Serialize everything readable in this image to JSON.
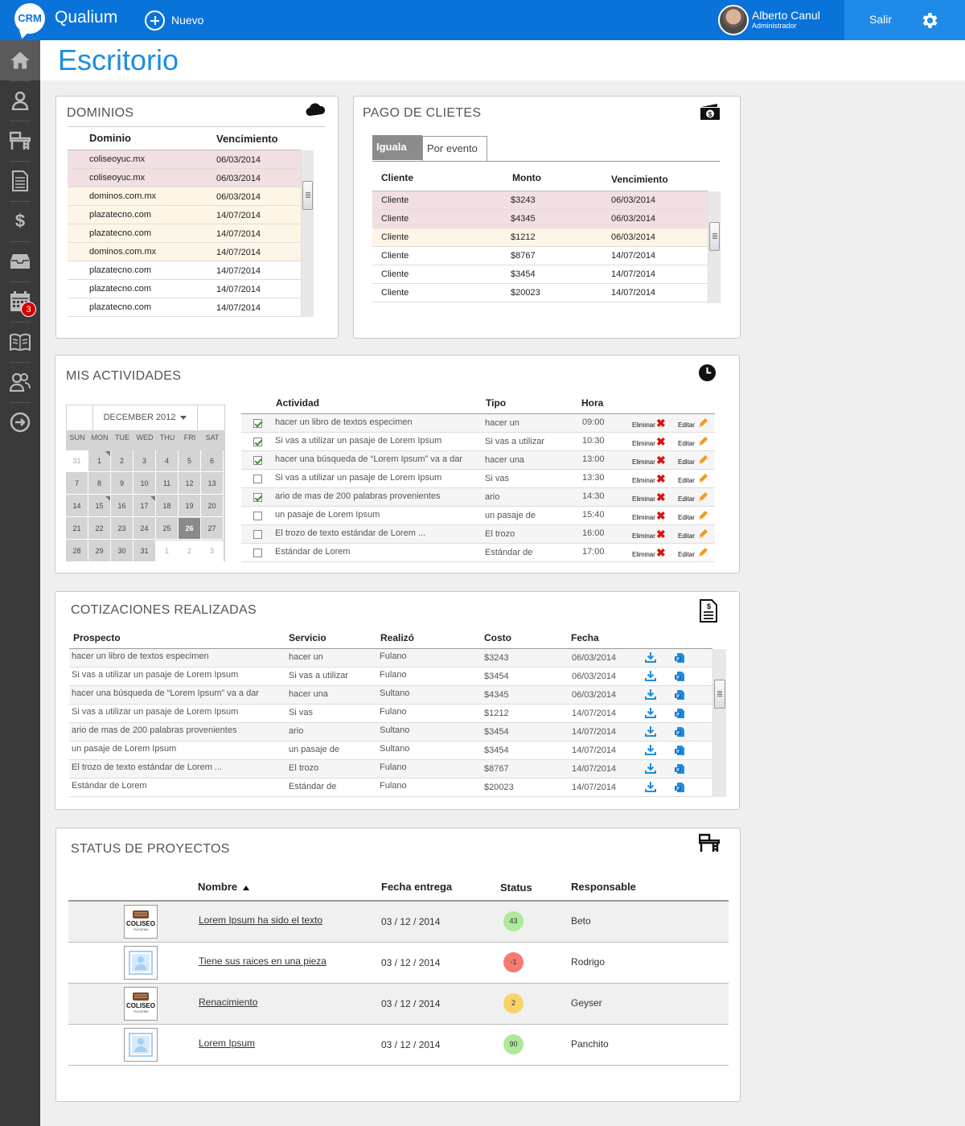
{
  "app": {
    "logo_text": "CRM",
    "name": "Qualium",
    "new_label": "Nuevo"
  },
  "user": {
    "name": "Alberto Canul",
    "role": "Administrador"
  },
  "header": {
    "logout_label": "Salir"
  },
  "page": {
    "title": "Escritorio"
  },
  "sidebar": {
    "notifications_badge": "3"
  },
  "dominios": {
    "title": "DOMINIOS",
    "headers": [
      "Dominio",
      "Vencimiento"
    ],
    "rows": [
      {
        "dominio": "coliseoyuc.mx",
        "vencimiento": "06/03/2014",
        "status": "red"
      },
      {
        "dominio": "coliseoyuc.mx",
        "vencimiento": "06/03/2014",
        "status": "red"
      },
      {
        "dominio": "dominos.com.mx",
        "vencimiento": "06/03/2014",
        "status": "yellow"
      },
      {
        "dominio": "plazatecno.com",
        "vencimiento": "14/07/2014",
        "status": "yellow"
      },
      {
        "dominio": "plazatecno.com",
        "vencimiento": "14/07/2014",
        "status": "yellow"
      },
      {
        "dominio": "dominos.com.mx",
        "vencimiento": "14/07/2014",
        "status": "yellow"
      },
      {
        "dominio": "plazatecno.com",
        "vencimiento": "14/07/2014",
        "status": "white"
      },
      {
        "dominio": "plazatecno.com",
        "vencimiento": "14/07/2014",
        "status": "white"
      },
      {
        "dominio": "plazatecno.com",
        "vencimiento": "14/07/2014",
        "status": "white"
      }
    ]
  },
  "pago": {
    "title": "PAGO DE CLIETES",
    "tabs": [
      "Iguala",
      "Por evento"
    ],
    "headers": [
      "Cliente",
      "Monto",
      "Vencimiento"
    ],
    "rows": [
      {
        "cliente": "Cliente",
        "monto": "$3243",
        "vencimiento": "06/03/2014",
        "status": "red"
      },
      {
        "cliente": "Cliente",
        "monto": "$4345",
        "vencimiento": "06/03/2014",
        "status": "red"
      },
      {
        "cliente": "Cliente",
        "monto": "$1212",
        "vencimiento": "06/03/2014",
        "status": "yellow"
      },
      {
        "cliente": "Cliente",
        "monto": "$8767",
        "vencimiento": "14/07/2014",
        "status": "white"
      },
      {
        "cliente": "Cliente",
        "monto": "$3454",
        "vencimiento": "14/07/2014",
        "status": "white"
      },
      {
        "cliente": "Cliente",
        "monto": "$20023",
        "vencimiento": "14/07/2014",
        "status": "white"
      }
    ]
  },
  "actividades": {
    "title": "MIS ACTIVIDADES",
    "calendar": {
      "month": "DECEMBER 2012",
      "weekdays": [
        "SUN",
        "MON",
        "TUE",
        "WED",
        "THU",
        "FRI",
        "SAT"
      ],
      "weeks": [
        [
          "31",
          "1",
          "2",
          "3",
          "4",
          "5",
          "6"
        ],
        [
          "7",
          "8",
          "9",
          "10",
          "11",
          "12",
          "13"
        ],
        [
          "14",
          "15",
          "16",
          "17",
          "18",
          "19",
          "20"
        ],
        [
          "21",
          "22",
          "23",
          "24",
          "25",
          "26",
          "27"
        ],
        [
          "28",
          "29",
          "30",
          "31",
          "1",
          "2",
          "3"
        ]
      ],
      "selected": "26"
    },
    "headers": [
      "Actividad",
      "Tipo",
      "Hora"
    ],
    "delete_label": "Eliminar",
    "edit_label": "Editar",
    "rows": [
      {
        "checked": true,
        "actividad": "hacer un libro de textos especimen",
        "tipo": "hacer un",
        "hora": "09:00"
      },
      {
        "checked": true,
        "actividad": "Si vas a utilizar un pasaje de Lorem Ipsum",
        "tipo": "Si vas a utilizar",
        "hora": "10:30"
      },
      {
        "checked": true,
        "actividad": "hacer una búsqueda de “Lorem Ipsum” va a dar",
        "tipo": "hacer una",
        "hora": "13:00"
      },
      {
        "checked": false,
        "actividad": "Si vas a utilizar un pasaje de Lorem Ipsum",
        "tipo": "Si vas",
        "hora": "13:30"
      },
      {
        "checked": true,
        "actividad": "ario de mas de 200 palabras provenientes",
        "tipo": "ario",
        "hora": "14:30"
      },
      {
        "checked": false,
        "actividad": "un pasaje de Lorem Ipsum",
        "tipo": "un pasaje de",
        "hora": "15:40"
      },
      {
        "checked": false,
        "actividad": "El trozo de texto estándar de Lorem ...",
        "tipo": "El trozo",
        "hora": "16:00"
      },
      {
        "checked": false,
        "actividad": "Estándar de Lorem",
        "tipo": "Estándar de",
        "hora": "17:00"
      }
    ]
  },
  "cotizaciones": {
    "title": "COTIZACIONES REALIZADAS",
    "headers": [
      "Prospecto",
      "Servicio",
      "Realizó",
      "Costo",
      "Fecha"
    ],
    "rows": [
      {
        "prospecto": "hacer un libro de textos especimen",
        "servicio": "hacer un",
        "realizo": "Fulano",
        "costo": "$3243",
        "fecha": "06/03/2014"
      },
      {
        "prospecto": "Si vas a utilizar un pasaje de Lorem Ipsum",
        "servicio": "Si vas a utilizar",
        "realizo": "Fulano",
        "costo": "$3454",
        "fecha": "06/03/2014"
      },
      {
        "prospecto": "hacer una búsqueda de “Lorem Ipsum” va a dar",
        "servicio": "hacer una",
        "realizo": "Sultano",
        "costo": "$4345",
        "fecha": "06/03/2014"
      },
      {
        "prospecto": "Si vas a utilizar un pasaje de Lorem Ipsum",
        "servicio": "Si vas",
        "realizo": "Fulano",
        "costo": "$1212",
        "fecha": "14/07/2014"
      },
      {
        "prospecto": "ario de mas de 200 palabras provenientes",
        "servicio": "ario",
        "realizo": "Sultano",
        "costo": "$3454",
        "fecha": "14/07/2014"
      },
      {
        "prospecto": "un pasaje de Lorem Ipsum",
        "servicio": "un pasaje de",
        "realizo": "Sultano",
        "costo": "$3454",
        "fecha": "14/07/2014"
      },
      {
        "prospecto": "El trozo de texto estándar de Lorem ...",
        "servicio": "El trozo",
        "realizo": "Fulano",
        "costo": "$8767",
        "fecha": "14/07/2014"
      },
      {
        "prospecto": "Estándar de Lorem",
        "servicio": "Estándar de",
        "realizo": "Fulano",
        "costo": "$20023",
        "fecha": "14/07/2014"
      }
    ]
  },
  "proyectos": {
    "title": "STATUS DE PROYECTOS",
    "headers": [
      "Nombre",
      "Fecha entrega",
      "Status",
      "Responsable"
    ],
    "coliseo_logo": {
      "line1": "COLISEO",
      "line2": "YUCATÁN"
    },
    "rows": [
      {
        "logo": "coliseo",
        "nombre": "Lorem Ipsum ha sido el texto",
        "fecha": "03 / 12 / 2014",
        "status": "43",
        "status_color": "#aee89a",
        "responsable": "Beto"
      },
      {
        "logo": "placeholder",
        "nombre": "Tiene sus raices en una pieza",
        "fecha": "03 / 12 / 2014",
        "status": "-1",
        "status_color": "#f47a72",
        "responsable": "Rodrigo"
      },
      {
        "logo": "coliseo",
        "nombre": "Renacimiento",
        "fecha": "03 / 12 / 2014",
        "status": "2",
        "status_color": "#f8d36a",
        "responsable": "Geyser"
      },
      {
        "logo": "placeholder",
        "nombre": "Lorem Ipsum",
        "fecha": "03 / 12 / 2014",
        "status": "90",
        "status_color": "#aee89a",
        "responsable": "Panchito"
      }
    ]
  },
  "colors": {
    "primary": "#0a73d9",
    "row_red": "#f2dfe1",
    "row_yellow": "#fdf5e6",
    "title_blue": "#1a8fe0",
    "icon_blue": "#1a8fe0"
  },
  "icons": {
    "sidebar": [
      "home-icon",
      "user-icon",
      "desk-icon",
      "document-icon",
      "dollar-icon",
      "inbox-icon",
      "calendar-icon",
      "book-icon",
      "users-icon",
      "logout-icon"
    ]
  }
}
